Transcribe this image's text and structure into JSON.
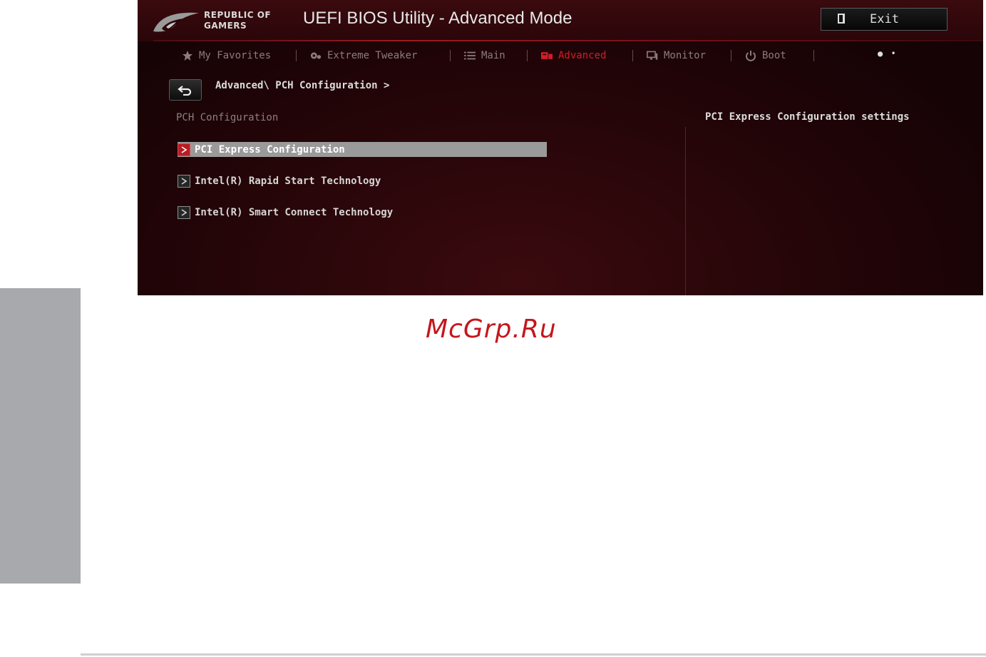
{
  "header": {
    "brand_line1": "REPUBLIC OF",
    "brand_line2": "GAMERS",
    "title": "UEFI BIOS Utility - Advanced Mode",
    "exit_label": "Exit"
  },
  "nav": {
    "items": [
      {
        "label": "My Favorites",
        "icon": "star-icon"
      },
      {
        "label": "Extreme Tweaker",
        "icon": "tweaker-icon"
      },
      {
        "label": "Main",
        "icon": "list-icon"
      },
      {
        "label": "Advanced",
        "icon": "advanced-icon",
        "active": true
      },
      {
        "label": "Monitor",
        "icon": "monitor-icon"
      },
      {
        "label": "Boot",
        "icon": "power-icon"
      }
    ],
    "page_indicator": "● •"
  },
  "breadcrumb": "Advanced\\ PCH Configuration >",
  "section_title": "PCH Configuration",
  "menu": {
    "items": [
      {
        "label": "PCI Express Configuration",
        "selected": true
      },
      {
        "label": "Intel(R) Rapid Start Technology",
        "selected": false
      },
      {
        "label": "Intel(R) Smart Connect Technology",
        "selected": false
      }
    ]
  },
  "help_text": "PCI Express Configuration settings",
  "watermark": "McGrp.Ru",
  "colors": {
    "accent": "#d41d28",
    "background": "#250508",
    "side_tab": "#a7a9ac",
    "selected_row": "#9a9a9a"
  }
}
